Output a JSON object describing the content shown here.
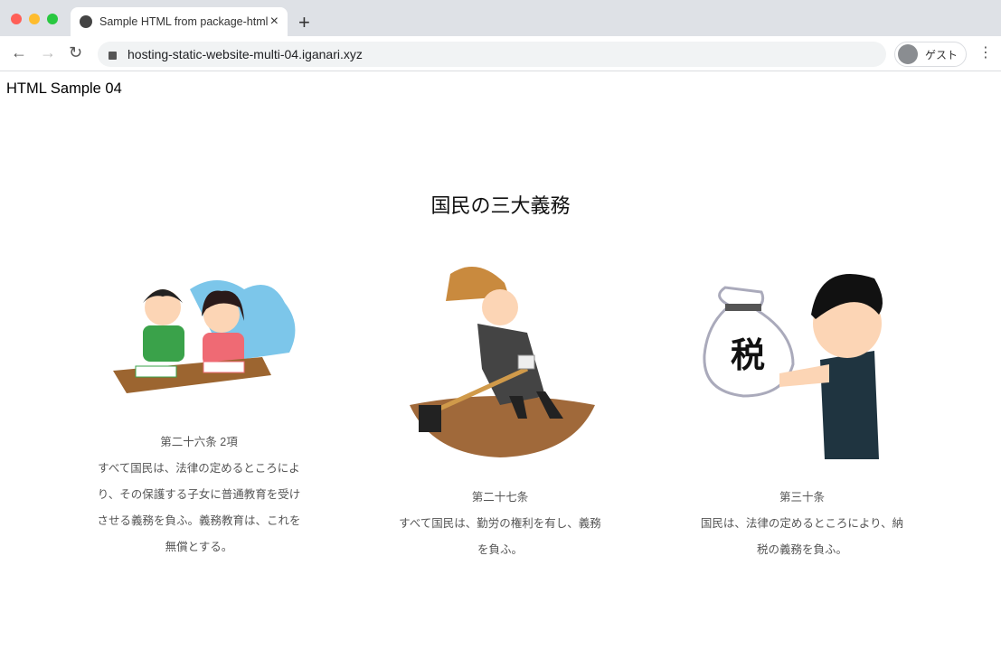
{
  "browser": {
    "tab_title": "Sample HTML from package-html",
    "url": "hosting-static-website-multi-04.iganari.xyz",
    "profile_label": "ゲスト",
    "new_tab": "+",
    "close": "×"
  },
  "page": {
    "site_title": "HTML Sample 04",
    "heading": "国民の三大義務",
    "items": [
      {
        "article": "第二十六条 2項",
        "text": "すべて国民は、法律の定めるところにより、その保護する子女に普通教育を受けさせる義務を負ふ。義務教育は、これを無償とする。",
        "image": "children-studying-illustration"
      },
      {
        "article": "第二十七条",
        "text": "すべて国民は、勤労の権利を有し、義務を負ふ。",
        "image": "worker-digging-illustration"
      },
      {
        "article": "第三十条",
        "text": "国民は、法律の定めるところにより、納税の義務を負ふ。",
        "image": "man-with-tax-bag-illustration",
        "bag_label": "税"
      }
    ]
  }
}
